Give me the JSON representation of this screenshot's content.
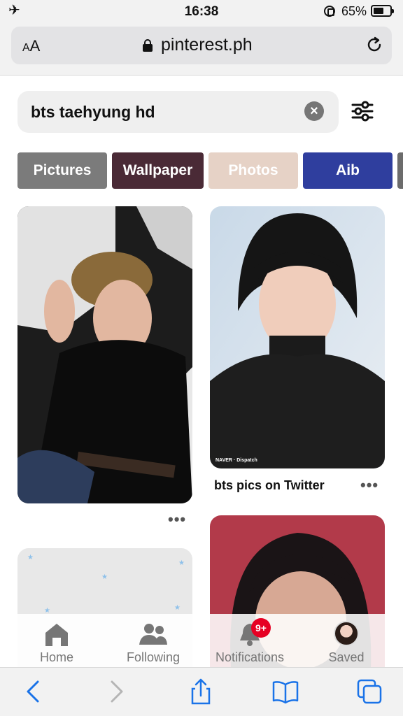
{
  "status_bar": {
    "time": "16:38",
    "battery_percent": "65%",
    "battery_level": 0.65,
    "icons": [
      "airplane-icon",
      "orientation-lock-icon",
      "battery-icon"
    ]
  },
  "browser": {
    "text_size_label_small": "A",
    "text_size_label_large": "A",
    "url": "pinterest.ph",
    "icons": [
      "padlock-icon",
      "reload-icon"
    ]
  },
  "search": {
    "query": "bts taehyung hd",
    "clear_symbol": "×",
    "icons": [
      "clear-icon",
      "filter-icon"
    ]
  },
  "chips": [
    {
      "label": "Pictures",
      "color": "#7b7b7b"
    },
    {
      "label": "Wallpaper",
      "color": "#4a2a36"
    },
    {
      "label": "Photos",
      "color": "#e6d2c6"
    },
    {
      "label": "Aib",
      "color": "#2f3e9e"
    }
  ],
  "pins": [
    {
      "caption": "",
      "colors": [
        "#d9d9d9",
        "#121212"
      ]
    },
    {
      "caption": "bts pics on Twitter",
      "watermark": "NAVER · Dispatch",
      "colors": [
        "#cfdbe6",
        "#161616"
      ]
    },
    {
      "caption": "",
      "colors": [
        "#e8e8e8",
        "#8fc1ea"
      ]
    },
    {
      "caption": "",
      "colors": [
        "#1a1416",
        "#b23a4a"
      ]
    }
  ],
  "more_symbol": "•••",
  "pinterest_nav": {
    "items": [
      {
        "label": "Home",
        "icon": "home-icon"
      },
      {
        "label": "Following",
        "icon": "following-icon"
      },
      {
        "label": "Notifications",
        "icon": "bell-icon",
        "badge": "9+"
      },
      {
        "label": "Saved",
        "icon": "avatar-icon"
      }
    ]
  },
  "safari_toolbar": {
    "icons": [
      "back-icon",
      "forward-icon",
      "share-icon",
      "bookmarks-icon",
      "tabs-icon"
    ],
    "accent": "#1a73e8"
  }
}
